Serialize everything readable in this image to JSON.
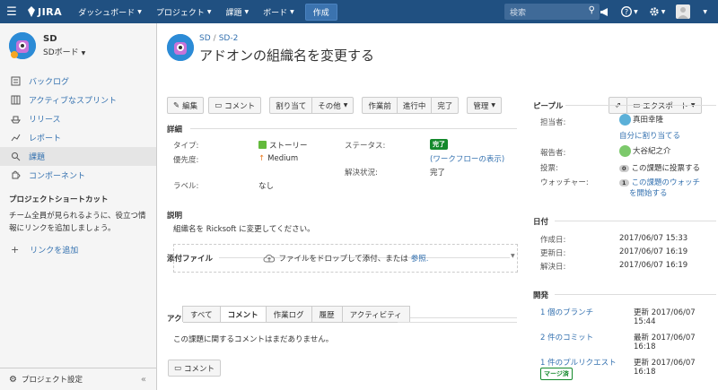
{
  "topnav": {
    "logo": "JIRA",
    "items": [
      "ダッシュボード",
      "プロジェクト",
      "課題",
      "ボード"
    ],
    "create": "作成",
    "search_placeholder": "検索"
  },
  "sidebar": {
    "project_name": "SD",
    "board": "SDボード",
    "items": [
      {
        "label": "バックログ",
        "icon": "backlog-icon"
      },
      {
        "label": "アクティブなスプリント",
        "icon": "board-icon"
      },
      {
        "label": "リリース",
        "icon": "ship-icon"
      },
      {
        "label": "レポート",
        "icon": "chart-icon"
      },
      {
        "label": "課題",
        "icon": "search-issues-icon"
      },
      {
        "label": "コンポーネント",
        "icon": "puzzle-icon"
      }
    ],
    "shortcut_title": "プロジェクトショートカット",
    "shortcut_desc": "チーム全員が見られるように、役立つ情報にリンクを追加しましょう。",
    "add_link": "リンクを追加",
    "footer": "プロジェクト設定"
  },
  "issue": {
    "crumb_project": "SD",
    "crumb_key": "SD-2",
    "summary": "アドオンの組織名を変更する"
  },
  "toolbar": {
    "edit": "編集",
    "comment": "コメント",
    "assign": "割り当て",
    "more": "その他",
    "wf1": "作業前",
    "wf2": "進行中",
    "wf3": "完了",
    "admin": "管理",
    "export": "エクスポート"
  },
  "details": {
    "title": "詳細",
    "type_label": "タイプ:",
    "type_value": "ストーリー",
    "priority_label": "優先度:",
    "priority_value": "Medium",
    "labels_label": "ラベル:",
    "labels_value": "なし",
    "status_label": "ステータス:",
    "status_value": "完了",
    "workflow_link": "(ワークフローの表示)",
    "resolution_label": "解決状況:",
    "resolution_value": "完了"
  },
  "description": {
    "title": "説明",
    "text": "組織名を Ricksoft に変更してください。"
  },
  "attachments": {
    "title": "添付ファイル",
    "drop_text": "ファイルをドロップして添付、または",
    "browse": "参照."
  },
  "activity": {
    "title": "アクティビティ",
    "tabs": [
      "すべて",
      "コメント",
      "作業ログ",
      "履歴",
      "アクティビティ"
    ],
    "empty": "この課題に関するコメントはまだありません。",
    "comment_button": "コメント"
  },
  "people": {
    "title": "ピープル",
    "assignee_label": "担当者:",
    "assignee": "真田幸隆",
    "assign_me": "自分に割り当てる",
    "reporter_label": "報告者:",
    "reporter": "大谷紀之介",
    "votes_label": "投票:",
    "votes_count": "0",
    "votes_text": "この課題に投票する",
    "watchers_label": "ウォッチャー:",
    "watchers_count": "1",
    "watchers_text_1": "この課題のウォッチ",
    "watchers_text_2": "を開始する"
  },
  "dates": {
    "title": "日付",
    "created_label": "作成日:",
    "created": "2017/06/07 15:33",
    "updated_label": "更新日:",
    "updated": "2017/06/07 16:19",
    "resolved_label": "解決日:",
    "resolved": "2017/06/07 16:19"
  },
  "development": {
    "title": "開発",
    "branch": "1 個のブランチ",
    "branch_meta_1": "更新 2017/06/07",
    "branch_meta_2": "15:44",
    "commits": "2 件のコミット",
    "commits_meta_1": "最新 2017/06/07",
    "commits_meta_2": "16:18",
    "pr": "1 件のプルリクエスト",
    "pr_status": "マージ済",
    "pr_meta_1": "更新 2017/06/07",
    "pr_meta_2": "16:18"
  },
  "colors": {
    "topbar": "#205081",
    "link": "#3572b0",
    "done": "#14892c"
  }
}
